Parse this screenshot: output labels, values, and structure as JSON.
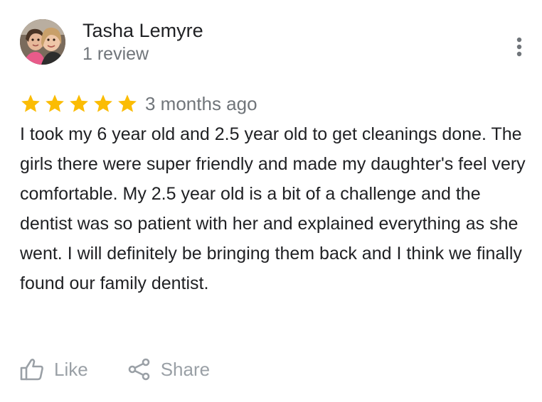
{
  "review": {
    "author_name": "Tasha Lemyre",
    "review_count": "1 review",
    "rating": 5,
    "rating_max": 5,
    "date": "3 months ago",
    "text": "I took my 6 year old and 2.5 year old to get cleanings done. The girls there were super friendly and made my daughter's feel very comfortable. My 2.5 year old is a bit of a challenge and the dentist was so patient with her and explained everything as she went. I will definitely be bringing them back and I think we finally found our family dentist."
  },
  "actions": {
    "like_label": "Like",
    "share_label": "Share"
  },
  "icons": {
    "avatar": "user-photo",
    "more": "more-vert-icon",
    "star": "star-icon",
    "like": "thumb-up-icon",
    "share": "share-icon"
  },
  "colors": {
    "star": "#fbbc04",
    "text_primary": "#202124",
    "text_secondary": "#70757a",
    "action": "#9aa0a6"
  }
}
